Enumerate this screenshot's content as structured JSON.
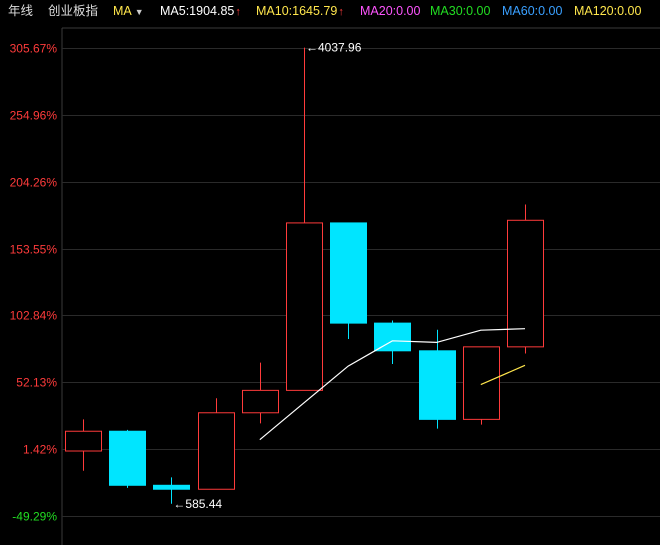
{
  "header": {
    "period_label": "年线",
    "index_name": "创业板指",
    "indicator": "MA",
    "ma_items": [
      {
        "label": "MA5:1904.85",
        "color": "#ffffff",
        "arrow": "↑"
      },
      {
        "label": "MA10:1645.79",
        "color": "#ffe64c",
        "arrow": "↑"
      },
      {
        "label": "MA20:0.00",
        "color": "#ff55ff",
        "arrow": ""
      },
      {
        "label": "MA30:0.00",
        "color": "#22dd22",
        "arrow": ""
      },
      {
        "label": "MA60:0.00",
        "color": "#3aa0ff",
        "arrow": ""
      },
      {
        "label": "MA120:0.00",
        "color": "#ffe64c",
        "arrow": ""
      }
    ]
  },
  "chart_data": {
    "type": "candlestick",
    "y_ticks": [
      {
        "label": "305.67%",
        "value": 305.67,
        "color": "#ff3b3b"
      },
      {
        "label": "254.96%",
        "value": 254.96,
        "color": "#ff3b3b"
      },
      {
        "label": "204.26%",
        "value": 204.26,
        "color": "#ff3b3b"
      },
      {
        "label": "153.55%",
        "value": 153.55,
        "color": "#ff3b3b"
      },
      {
        "label": "102.84%",
        "value": 102.84,
        "color": "#ff3b3b"
      },
      {
        "label": "52.13%",
        "value": 52.13,
        "color": "#ff3b3b"
      },
      {
        "label": "1.42%",
        "value": 1.42,
        "color": "#ff3b3b"
      },
      {
        "label": "-49.29%",
        "value": -49.29,
        "color": "#22dd22"
      }
    ],
    "ylim": [
      -49.29,
      305.67
    ],
    "candles": [
      {
        "open": 0,
        "close": 15,
        "high": 24,
        "low": -15
      },
      {
        "open": 15,
        "close": -26,
        "high": 16,
        "low": -28
      },
      {
        "open": -26,
        "close": -29,
        "high": -20,
        "low": -40
      },
      {
        "open": -29,
        "close": 29,
        "high": 40,
        "low": -29
      },
      {
        "open": 29,
        "close": 46,
        "high": 67,
        "low": 21
      },
      {
        "open": 46,
        "close": 173,
        "high": 306,
        "low": 46
      },
      {
        "open": 173,
        "close": 97,
        "high": 173,
        "low": 85
      },
      {
        "open": 97,
        "close": 76,
        "high": 99,
        "low": 66
      },
      {
        "open": 76,
        "close": 24,
        "high": 92,
        "low": 17
      },
      {
        "open": 24,
        "close": 79,
        "high": 79,
        "low": 20
      },
      {
        "open": 79,
        "close": 175,
        "high": 187,
        "low": 74
      }
    ],
    "ma5": [
      null,
      null,
      null,
      null,
      8.6,
      36.6,
      64.4,
      83.6,
      82.4,
      91.6,
      92.8
    ],
    "ma10": [
      null,
      null,
      null,
      null,
      null,
      null,
      null,
      null,
      null,
      50.4,
      65
    ],
    "annotations": [
      {
        "label": "4037.96",
        "candle": 5,
        "value": 306
      },
      {
        "label": "585.44",
        "candle": 2,
        "value": -40
      }
    ],
    "colors": {
      "up": "#ff3b3b",
      "down": "#00e5ff",
      "grid": "#2a2a2a",
      "ma5": "#ffffff",
      "ma10": "#ffe64c"
    }
  }
}
